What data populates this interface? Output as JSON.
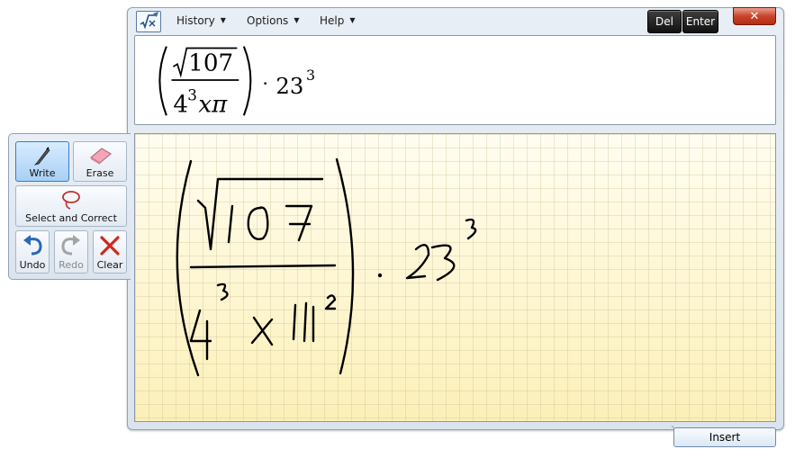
{
  "menu": {
    "history": "History",
    "options": "Options",
    "help": "Help"
  },
  "keys": {
    "del": "Del",
    "enter": "Enter"
  },
  "close_symbol": "✕",
  "preview": {
    "numerator": "107",
    "denominator_base": "4",
    "denominator_exp": "3",
    "denominator_var": "xπ",
    "dot": "·",
    "term": "23",
    "term_exp": "3"
  },
  "tools": {
    "write": "Write",
    "erase": "Erase",
    "select": "Select and Correct",
    "undo": "Undo",
    "redo": "Redo",
    "clear": "Clear"
  },
  "insert_label": "Insert",
  "colors": {
    "pad_bg": "#fdf6d2",
    "frame": "#8ea2ba",
    "active_tool": "#a9cff5"
  }
}
